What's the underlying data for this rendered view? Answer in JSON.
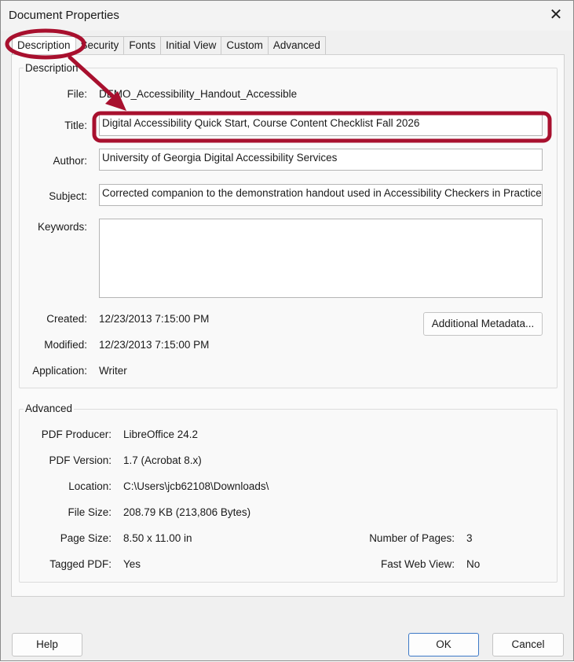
{
  "window": {
    "title": "Document Properties",
    "close_symbol": "✕"
  },
  "tabs": [
    {
      "label": "Description",
      "active": true
    },
    {
      "label": "Security",
      "active": false
    },
    {
      "label": "Fonts",
      "active": false
    },
    {
      "label": "Initial View",
      "active": false
    },
    {
      "label": "Custom",
      "active": false
    },
    {
      "label": "Advanced",
      "active": false
    }
  ],
  "description": {
    "group_label": "Description",
    "file_label": "File:",
    "file_value": "DEMO_Accessibility_Handout_Accessible",
    "title_label": "Title:",
    "title_value": "Digital Accessibility Quick Start, Course Content Checklist Fall 2026",
    "author_label": "Author:",
    "author_value": "University of Georgia Digital Accessibility Services",
    "subject_label": "Subject:",
    "subject_value": "Corrected companion to the demonstration handout used in Accessibility Checkers in Practice.",
    "keywords_label": "Keywords:",
    "keywords_value": "",
    "created_label": "Created:",
    "created_value": "12/23/2013 7:15:00 PM",
    "modified_label": "Modified:",
    "modified_value": "12/23/2013 7:15:00 PM",
    "application_label": "Application:",
    "application_value": "Writer",
    "additional_metadata_label": "Additional Metadata..."
  },
  "advanced": {
    "group_label": "Advanced",
    "producer_label": "PDF Producer:",
    "producer_value": "LibreOffice 24.2",
    "version_label": "PDF Version:",
    "version_value": "1.7 (Acrobat 8.x)",
    "location_label": "Location:",
    "location_value": "C:\\Users\\jcb62108\\Downloads\\",
    "filesize_label": "File Size:",
    "filesize_value": "208.79 KB (213,806 Bytes)",
    "pagesize_label": "Page Size:",
    "pagesize_value": "8.50 x 11.00 in",
    "pages_label": "Number of Pages:",
    "pages_value": "3",
    "tagged_label": "Tagged PDF:",
    "tagged_value": "Yes",
    "fastweb_label": "Fast Web View:",
    "fastweb_value": "No"
  },
  "buttons": {
    "help": "Help",
    "ok": "OK",
    "cancel": "Cancel"
  },
  "annotation": {
    "color": "#a8102e"
  }
}
